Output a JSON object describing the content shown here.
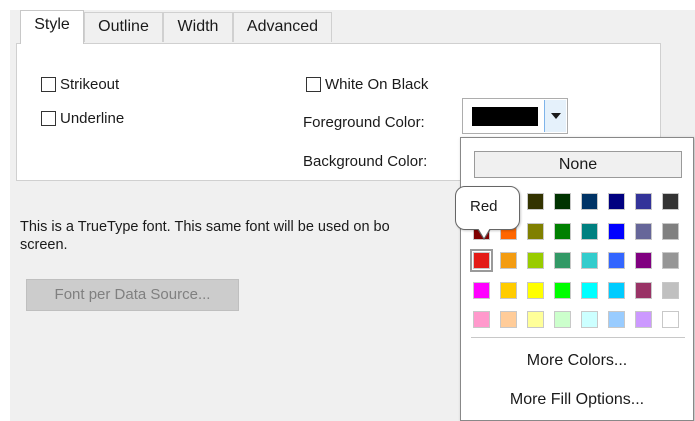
{
  "tabs": [
    {
      "label": "Style",
      "active": true
    },
    {
      "label": "Outline",
      "active": false
    },
    {
      "label": "Width",
      "active": false
    },
    {
      "label": "Advanced",
      "active": false
    }
  ],
  "checkboxes": {
    "strikeout": {
      "label": "Strikeout",
      "checked": false
    },
    "underline": {
      "label": "Underline",
      "checked": false
    },
    "white_on_black": {
      "label": "White On Black",
      "checked": false
    }
  },
  "labels": {
    "foreground_color": "Foreground Color:",
    "background_color": "Background Color:"
  },
  "foreground_color_value": "#000000",
  "info_line1": "This is a TrueType font. This same font will be used on bo",
  "info_line2": "screen.",
  "font_per_data_source_button": "Font per Data Source...",
  "color_picker": {
    "none_label": "None",
    "tooltip": "Red",
    "selected_color": "#e41b17",
    "more_colors": "More Colors...",
    "more_fill_options": "More Fill Options...",
    "rows": [
      [
        "#000000",
        "#993300",
        "#333300",
        "#003300",
        "#003366",
        "#000080",
        "#333399",
        "#333333"
      ],
      [
        "#800000",
        "#ff6600",
        "#808000",
        "#008000",
        "#008080",
        "#0000ff",
        "#666699",
        "#808080"
      ],
      [
        "#e41b17",
        "#f39c12",
        "#99cc00",
        "#339966",
        "#33cccc",
        "#3366ff",
        "#800080",
        "#969696"
      ],
      [
        "#ff00ff",
        "#ffcc00",
        "#ffff00",
        "#00ff00",
        "#00ffff",
        "#00ccff",
        "#993366",
        "#c0c0c0"
      ],
      [
        "#ff99cc",
        "#ffcc99",
        "#ffff99",
        "#ccffcc",
        "#ccffff",
        "#99ccff",
        "#cc99ff",
        "#ffffff"
      ]
    ]
  }
}
